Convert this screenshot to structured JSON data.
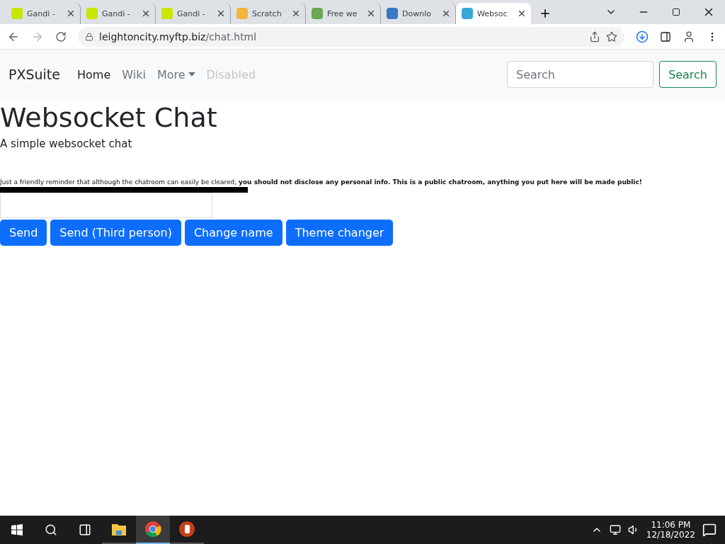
{
  "browser": {
    "tabs": [
      {
        "title": "Gandi -",
        "selected": false
      },
      {
        "title": "Gandi -",
        "selected": false
      },
      {
        "title": "Gandi -",
        "selected": false
      },
      {
        "title": "Scratch",
        "selected": false
      },
      {
        "title": "Free we",
        "selected": false
      },
      {
        "title": "Downlo",
        "selected": false
      },
      {
        "title": "Websoc",
        "selected": true
      }
    ],
    "address": {
      "host": "leightoncity.myftp.biz",
      "path": "/chat.html"
    }
  },
  "navbar": {
    "brand": "PXSuite",
    "links": [
      {
        "label": "Home",
        "kind": "active"
      },
      {
        "label": "Wiki",
        "kind": "normal"
      },
      {
        "label": "More",
        "kind": "dropdown"
      },
      {
        "label": "Disabled",
        "kind": "disabled"
      }
    ],
    "search": {
      "placeholder": "Search",
      "button": "Search"
    }
  },
  "page": {
    "title": "Websocket Chat",
    "subtitle": "A simple websocket chat",
    "reminder": "Just a friendly reminder that although the chatroom can easily be cleared, **you should not disclose any personal info. This is a public chatroom, anything you put here will be made public!**",
    "buttons": [
      "Send",
      "Send (Third person)",
      "Change name",
      "Theme changer"
    ]
  },
  "taskbar": {
    "apps": [
      {
        "kind": "folder",
        "selected": false
      },
      {
        "kind": "chrome",
        "selected": true
      },
      {
        "kind": "psiphon",
        "selected": false
      }
    ],
    "time": "11:06 PM",
    "date": "12/18/2022"
  }
}
